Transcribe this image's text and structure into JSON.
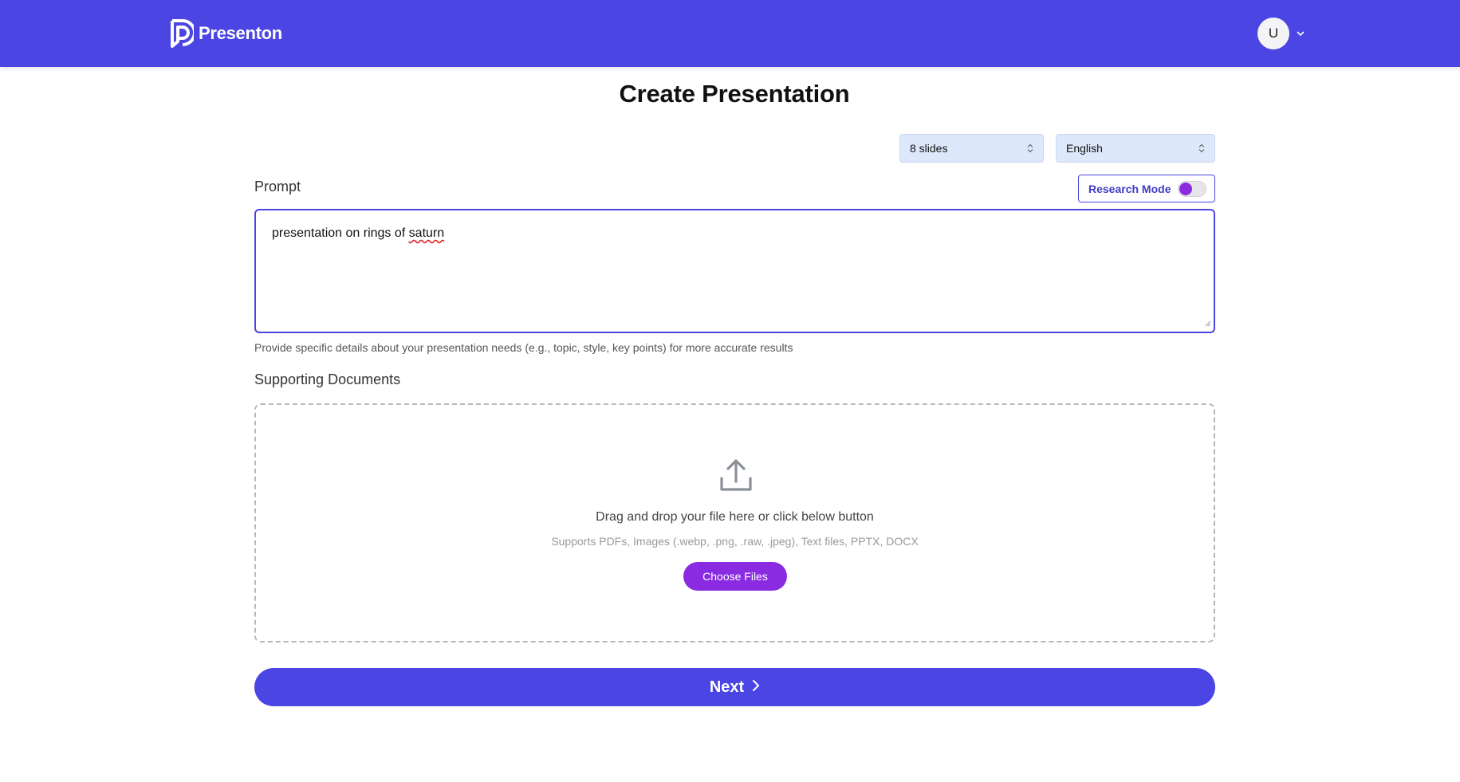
{
  "header": {
    "brand": "Presenton",
    "brand_icon": "presenton-logo-icon",
    "user_initial": "U",
    "bg_color": "#4b45e3"
  },
  "main": {
    "title": "Create Presentation",
    "slides_select": {
      "value": "8 slides"
    },
    "language_select": {
      "value": "English"
    },
    "prompt_label": "Prompt",
    "research_mode": {
      "label": "Research Mode",
      "enabled": false
    },
    "prompt_text_plain": "presentation on rings of ",
    "prompt_text_misspelled": "saturn",
    "hint": "Provide specific details about your presentation needs (e.g., topic, style, key points) for more accurate results",
    "docs_label": "Supporting Documents",
    "dropzone": {
      "icon": "upload-icon",
      "main_text": "Drag and drop your file here or click below button",
      "sub_text": "Supports PDFs, Images (.webp, .png, .raw, .jpeg), Text files, PPTX, DOCX",
      "button_label": "Choose Files",
      "button_color": "#8a2be2"
    },
    "next_button": {
      "label": "Next",
      "icon": "chevron-right-icon"
    }
  }
}
